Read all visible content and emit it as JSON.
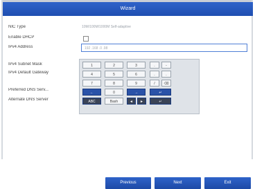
{
  "window": {
    "title": "Wizard"
  },
  "form": {
    "nic_type": {
      "label": "NIC Type",
      "value": "10M/100M/1000M Self-adaptive"
    },
    "enable_dhcp": {
      "label": "Enable DHCP",
      "checked": false
    },
    "ipv4_address": {
      "label": "IPv4 Address",
      "value": "192 .168 .0    .98"
    },
    "ipv4_subnet_mask": {
      "label": "IPv4 Subnet Mask"
    },
    "ipv4_default_gateway": {
      "label": "IPv4 Default Gateway"
    },
    "preferred_dns": {
      "label": "Preferred DNS Serv..."
    },
    "alternate_dns": {
      "label": "Alternate DNS Server"
    }
  },
  "keypad": {
    "row1": [
      "1",
      "2",
      "3",
      ".",
      "-"
    ],
    "row2": [
      "4",
      "5",
      "6",
      ".",
      "."
    ],
    "row3": [
      "7",
      "8",
      "9",
      "/",
      "⌫"
    ],
    "row4": [
      "←",
      "0",
      "→",
      "↵"
    ],
    "row5": [
      "ABC",
      "Bash",
      "◄",
      "►",
      "↵"
    ]
  },
  "footer": {
    "previous_label": "Previous",
    "next_label": "Next",
    "exit_label": "Exit"
  },
  "colors": {
    "header_blue": "#2f63c9",
    "key_blue": "#2a52a8",
    "button_blue": "#1d4aa6"
  }
}
